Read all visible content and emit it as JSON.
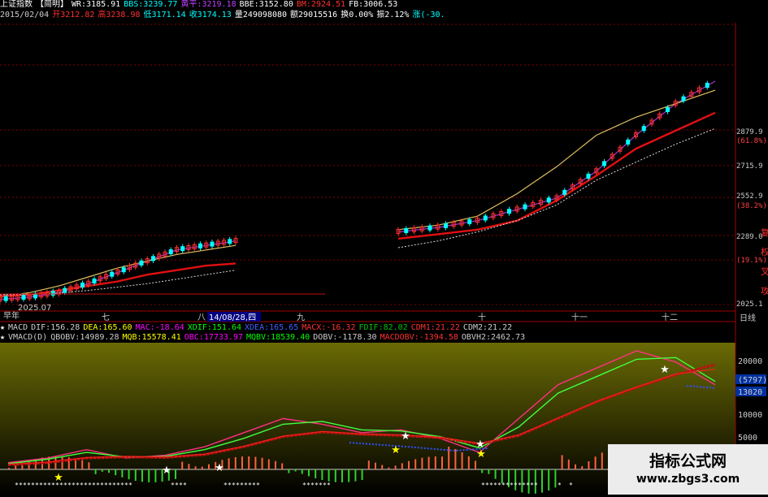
{
  "header": {
    "title": "上证指数",
    "mode": "【简明】",
    "wr": "WR:3185.91",
    "bbs": "BBS:3239.77",
    "yellow": "黄平:3219.18",
    "bbe": "BBE:3152.80",
    "red": "BM:2924.51",
    "fb": "FB:3006.53"
  },
  "quote": {
    "date": "2015/02/04",
    "open": "开3212.82",
    "high": "高3238.98",
    "low": "低3171.14",
    "close": "收3174.13",
    "volume": "量249098080",
    "amount": "额29015516",
    "turnover": "换0.00%",
    "amplitude": "振2.12%",
    "change": "涨(-30."
  },
  "price_axis": {
    "labels": [
      "2879.9",
      "(61.8%)",
      "2715.9",
      "2552.9",
      "(38.2%)",
      "2289.0",
      "(19.1%)",
      "2025.1"
    ],
    "side_chars": [
      "复",
      "权",
      "叉",
      "攻"
    ]
  },
  "time_axis": {
    "labels": [
      "早年",
      "2025.07",
      "七",
      "八",
      "14/08/28,四",
      "九",
      "十",
      "十一",
      "十二"
    ],
    "period": "日线"
  },
  "macd_line": {
    "star": "★",
    "items": [
      {
        "text": "MACD",
        "color": "#cccccc"
      },
      {
        "text": "DIF:156.28",
        "color": "#cccccc"
      },
      {
        "text": "DEA:165.60",
        "color": "#ffff00"
      },
      {
        "text": "MAC:-18.64",
        "color": "#ff00ff"
      },
      {
        "text": "XDIF:151.64",
        "color": "#00ff00"
      },
      {
        "text": "XDEA:165.65",
        "color": "#4060ff"
      },
      {
        "text": "MACX:-16.32",
        "color": "#ff3030"
      },
      {
        "text": "FDIF:82.02",
        "color": "#00c000"
      },
      {
        "text": "CDM1:21.22",
        "color": "#ff3030"
      },
      {
        "text": "CDM2:21.22",
        "color": "#cccccc"
      }
    ]
  },
  "vmacd_line": {
    "star": "★",
    "items": [
      {
        "text": "VMACD(D)",
        "color": "#cccccc"
      },
      {
        "text": "QBOBV:14989.28",
        "color": "#cccccc"
      },
      {
        "text": "MQB:15578.41",
        "color": "#ffff00"
      },
      {
        "text": "OBC:17733.97",
        "color": "#ff00ff"
      },
      {
        "text": "MQBV:18539.40",
        "color": "#00ff00"
      },
      {
        "text": "DOBV:-1178.30",
        "color": "#cccccc"
      },
      {
        "text": "MACDOBV:-1394.58",
        "color": "#ff3030"
      },
      {
        "text": "OBVH2:2462.73",
        "color": "#cccccc"
      }
    ]
  },
  "lower_axis": {
    "labels": [
      "20000",
      "(5797)",
      "13020",
      "10000",
      "5000"
    ]
  },
  "watermark": {
    "line1": "指标公式网",
    "line2": "www.zbgs3.com"
  },
  "colors": {
    "up": "#ff3030",
    "down": "#00ffff",
    "ma_purple": "#b030d0",
    "ma_yellow": "#e0c060",
    "ma_red": "#e01010",
    "ma_white_dotted": "#dddddd",
    "ma_green": "#40c040",
    "grid": "#800000",
    "lower_bg_top": "#6a6a05",
    "lower_bg_bottom": "#000000"
  },
  "chart_data": [
    {
      "type": "line",
      "title": "上证指数 日线",
      "x_ticks": [
        "2025.07",
        "七",
        "八",
        "九",
        "十",
        "十一",
        "十二"
      ],
      "y_ticks": [
        2025.1,
        2289.0,
        2552.9,
        2715.9,
        2879.9
      ],
      "y_ratio_labels": [
        "(19.1%)",
        "(38.2%)",
        "(61.8%)"
      ],
      "ylim": [
        2000,
        3000
      ],
      "series": [
        {
          "values": [
            2030,
            2040,
            2060,
            2100,
            2150,
            2200,
            2250,
            2270,
            2290,
            2330,
            2350,
            2380,
            2430,
            2480,
            2600,
            2760,
            2900,
            3000
          ]
        },
        {
          "values": [
            2040,
            2060,
            2090,
            2130,
            2170,
            2200,
            2230,
            2250,
            2270,
            2340,
            2360,
            2400,
            2500,
            2620,
            2760,
            2840,
            2900,
            2960
          ]
        },
        {
          "values": [
            2045,
            2050,
            2070,
            2090,
            2110,
            2140,
            2160,
            2180,
            2190,
            2300,
            2320,
            2340,
            2380,
            2470,
            2580,
            2700,
            2780,
            2860
          ]
        },
        {
          "values": [
            2050,
            2052,
            2058,
            2070,
            2085,
            2100,
            2120,
            2140,
            2160,
            2260,
            2290,
            2330,
            2380,
            2450,
            2560,
            2640,
            2720,
            2790
          ]
        }
      ]
    },
    {
      "type": "line",
      "title": "VMACD(D)",
      "y_ticks": [
        5000,
        10000,
        13020,
        20000
      ],
      "ylim": [
        0,
        22000
      ],
      "series": [
        {
          "name": "QBOBV",
          "values": [
            1200,
            2000,
            3500,
            2000,
            2500,
            4000,
            6500,
            9000,
            8000,
            6500,
            7000,
            5500,
            3000,
            9000,
            15000,
            18000,
            21000,
            19000,
            14990
          ]
        },
        {
          "name": "MQB",
          "values": [
            1000,
            1800,
            3000,
            2200,
            2300,
            3500,
            5500,
            8000,
            8500,
            7000,
            6800,
            5800,
            3800,
            7500,
            13500,
            16500,
            19500,
            19800,
            15578
          ]
        },
        {
          "name": "MQBV",
          "values": [
            800,
            1200,
            2000,
            2200,
            2100,
            2600,
            4000,
            5800,
            6600,
            6200,
            6000,
            5600,
            4500,
            6000,
            9000,
            12000,
            14500,
            16800,
            18539
          ]
        },
        {
          "name": "OBC",
          "values": [
            900,
            1300,
            2100,
            2300,
            2200,
            2700,
            4100,
            5900,
            6700,
            6300,
            6100,
            5700,
            4600,
            6100,
            9100,
            12100,
            14600,
            16900,
            17734
          ]
        }
      ]
    }
  ]
}
